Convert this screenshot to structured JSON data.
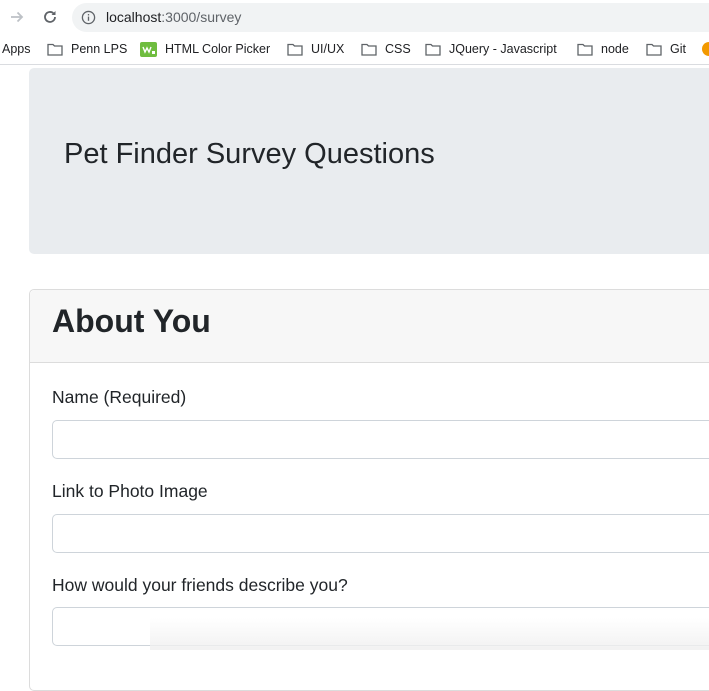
{
  "browser": {
    "url_host": "localhost",
    "url_path": ":3000/survey",
    "bookmarks": {
      "apps": "Apps",
      "items": [
        {
          "label": "Penn LPS",
          "icon": "folder-icon"
        },
        {
          "label": "HTML Color Picker",
          "icon": "color-picker-icon"
        },
        {
          "label": "UI/UX",
          "icon": "folder-icon"
        },
        {
          "label": "CSS",
          "icon": "folder-icon"
        },
        {
          "label": "JQuery - Javascript",
          "icon": "folder-icon"
        },
        {
          "label": "node",
          "icon": "folder-icon"
        },
        {
          "label": "Git",
          "icon": "folder-icon"
        }
      ]
    }
  },
  "jumbotron": {
    "title": "Pet Finder Survey Questions"
  },
  "card": {
    "title": "About You",
    "fields": [
      {
        "label": "Name (Required)",
        "value": ""
      },
      {
        "label": "Link to Photo Image",
        "value": ""
      },
      {
        "label": "How would your friends describe you?",
        "value": ""
      }
    ]
  },
  "colors": {
    "jumbotron_bg": "#e9ecef",
    "card_header_bg": "#f7f7f7",
    "input_border": "#ced4da"
  }
}
